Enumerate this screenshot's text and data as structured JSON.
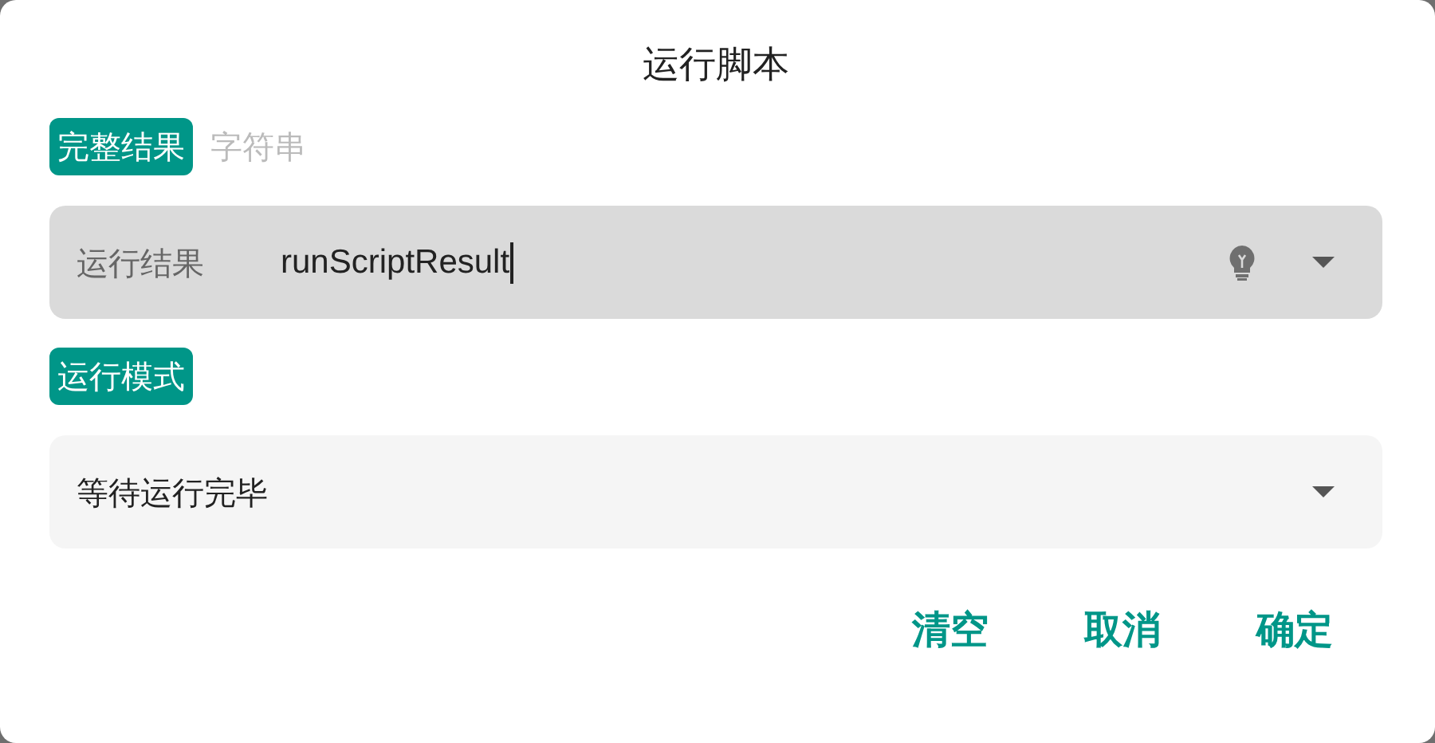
{
  "dialog": {
    "title": "运行脚本"
  },
  "result_tabs": [
    {
      "label": "完整结果",
      "selected": true
    },
    {
      "label": "字符串",
      "selected": false
    }
  ],
  "result_field": {
    "label": "运行结果",
    "value": "runScriptResult"
  },
  "mode_label": "运行模式",
  "mode_select": {
    "value": "等待运行完毕"
  },
  "buttons": [
    "清空",
    "取消",
    "确定"
  ]
}
